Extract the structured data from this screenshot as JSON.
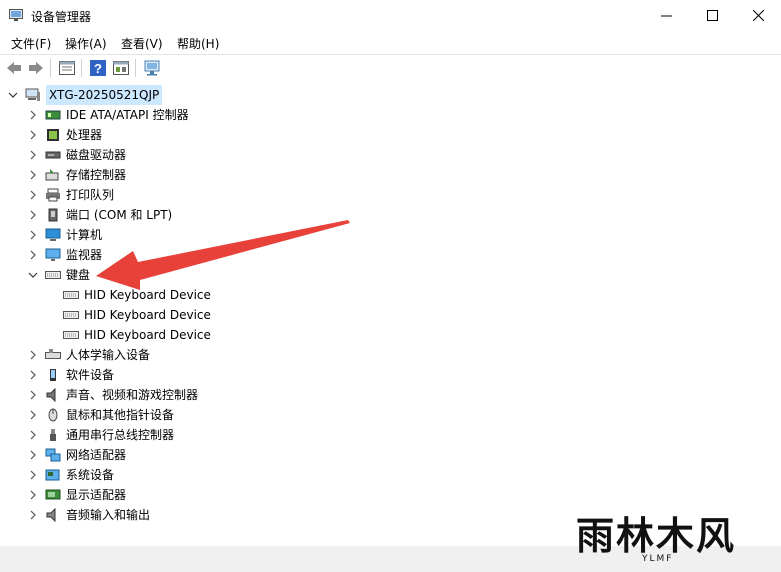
{
  "window": {
    "title": "设备管理器",
    "controls": [
      "minimize",
      "maximize",
      "close"
    ]
  },
  "menu": [
    "文件(F)",
    "操作(A)",
    "查看(V)",
    "帮助(H)"
  ],
  "toolbar": {
    "buttons": [
      "back-icon",
      "forward-icon",
      "properties-icon",
      "help-icon",
      "update-driver-icon",
      "scan-hardware-icon"
    ]
  },
  "tree": {
    "root": "XTG-20250521QJP",
    "categories": [
      {
        "label": "IDE ATA/ATAPI 控制器",
        "icon": "ide-controller-icon"
      },
      {
        "label": "处理器",
        "icon": "processor-icon"
      },
      {
        "label": "磁盘驱动器",
        "icon": "disk-drive-icon"
      },
      {
        "label": "存储控制器",
        "icon": "storage-controller-icon"
      },
      {
        "label": "打印队列",
        "icon": "printer-icon"
      },
      {
        "label": "端口 (COM 和 LPT)",
        "icon": "port-icon"
      },
      {
        "label": "计算机",
        "icon": "computer-icon"
      },
      {
        "label": "监视器",
        "icon": "monitor-icon"
      },
      {
        "label": "键盘",
        "icon": "keyboard-icon",
        "expanded": true,
        "children": [
          "HID Keyboard Device",
          "HID Keyboard Device",
          "HID Keyboard Device"
        ]
      },
      {
        "label": "人体学输入设备",
        "icon": "hid-icon"
      },
      {
        "label": "软件设备",
        "icon": "software-device-icon"
      },
      {
        "label": "声音、视频和游戏控制器",
        "icon": "audio-icon"
      },
      {
        "label": "鼠标和其他指针设备",
        "icon": "mouse-icon"
      },
      {
        "label": "通用串行总线控制器",
        "icon": "usb-icon"
      },
      {
        "label": "网络适配器",
        "icon": "network-adapter-icon"
      },
      {
        "label": "系统设备",
        "icon": "system-device-icon"
      },
      {
        "label": "显示适配器",
        "icon": "display-adapter-icon"
      },
      {
        "label": "音频输入和输出",
        "icon": "audio-io-icon"
      }
    ]
  },
  "watermark": {
    "main": "雨林木风",
    "sub": "YLMF"
  },
  "colors": {
    "selection": "#cce8ff",
    "arrow": "#e8413a",
    "monitor": "#2d8fd6"
  }
}
